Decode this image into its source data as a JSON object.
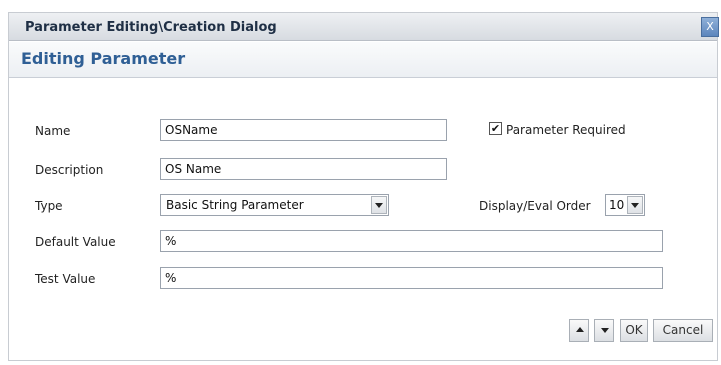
{
  "dialog": {
    "title": "Parameter Editing\\Creation Dialog",
    "close_label": "X",
    "header": "Editing Parameter"
  },
  "form": {
    "name_label": "Name",
    "name_value": "OSName",
    "description_label": "Description",
    "description_value": "OS Name",
    "type_label": "Type",
    "type_value": "Basic String Parameter",
    "default_label": "Default Value",
    "default_value": "%",
    "test_label": "Test Value",
    "test_value": "%",
    "required_label": "Parameter Required",
    "required_checked": true,
    "required_mark": "✔",
    "order_label": "Display/Eval Order",
    "order_value": "10"
  },
  "buttons": {
    "ok": "OK",
    "cancel": "Cancel"
  }
}
